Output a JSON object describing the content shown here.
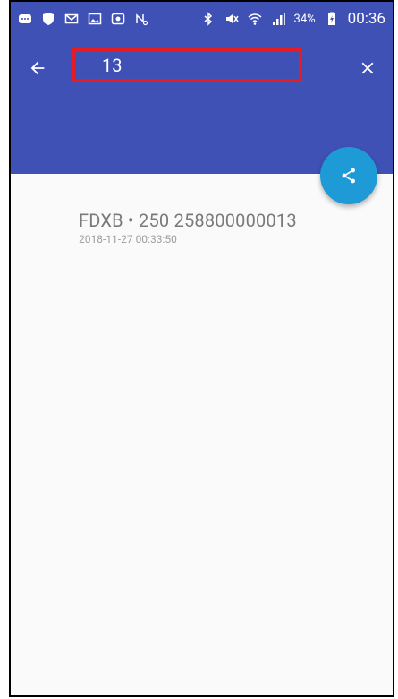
{
  "status_bar": {
    "battery": "34%",
    "time": "00:36"
  },
  "search": {
    "value": "13"
  },
  "results": [
    {
      "title": "FDXB • 250 258800000013",
      "timestamp": "2018-11-27 00:33:50"
    }
  ],
  "icons": {
    "back": "arrow-left-icon",
    "close": "close-icon",
    "share": "share-icon"
  },
  "colors": {
    "app_bar": "#3f51b5",
    "fab": "#1e9ad6",
    "highlight": "#e51c23"
  }
}
